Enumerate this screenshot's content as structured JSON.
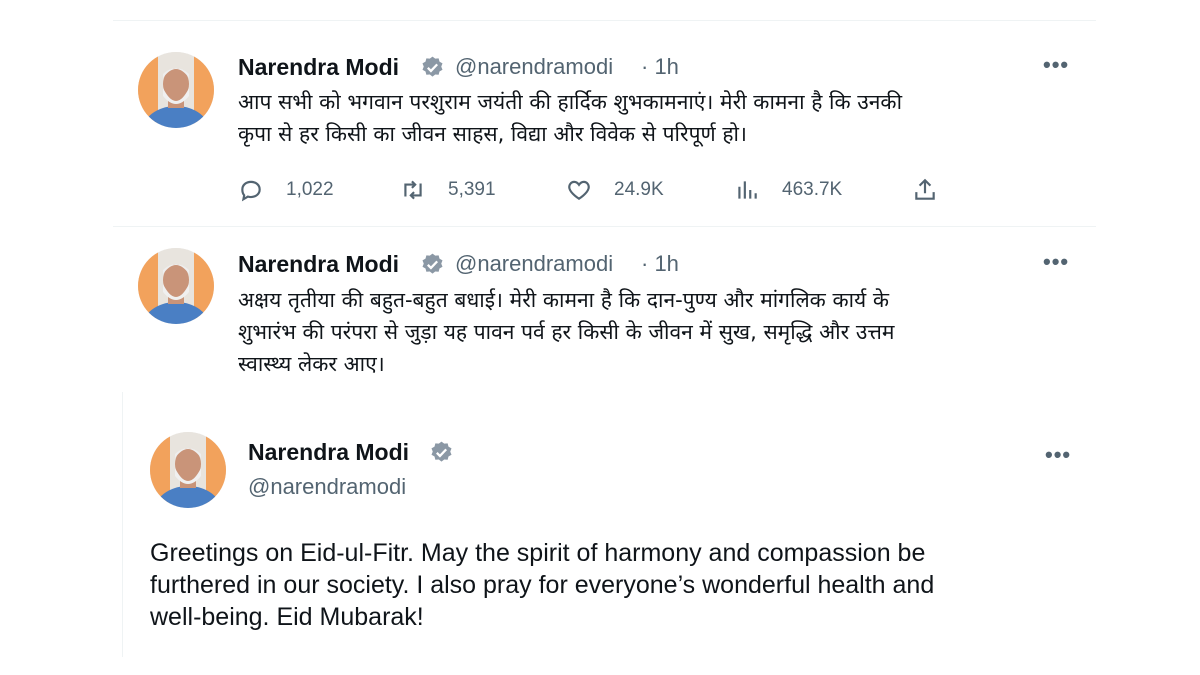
{
  "tweets": [
    {
      "author": "Narendra Modi",
      "handle": "@narendramodi",
      "time": "· 1h",
      "text_lines": [
        "आप सभी को भगवान परशुराम जयंती की हार्दिक शुभकामनाएं। मेरी कामना है कि उनकी",
        "कृपा से हर किसी का जीवन साहस, विद्या और विवेक से परिपूर्ण हो।"
      ],
      "replies": "1,022",
      "retweets": "5,391",
      "likes": "24.9K",
      "views": "463.7K"
    },
    {
      "author": "Narendra Modi",
      "handle": "@narendramodi",
      "time": "· 1h",
      "text_lines": [
        "अक्षय तृतीया की बहुत-बहुत बधाई। मेरी कामना है कि दान-पुण्य और मांगलिक कार्य के",
        "शुभारंभ की परंपरा से जुड़ा यह पावन पर्व हर किसी के जीवन में सुख, समृद्धि और उत्तम",
        "स्वास्थ्य लेकर आए।"
      ]
    },
    {
      "author": "Narendra Modi",
      "handle": "@narendramodi",
      "text_lines": [
        "Greetings on Eid-ul-Fitr. May the spirit of harmony and compassion be",
        "furthered in our society. I also pray for everyone’s wonderful health and",
        "well-being. Eid Mubarak!"
      ]
    }
  ],
  "more_label": "•••",
  "icons": [
    "avatar",
    "verified-badge-icon",
    "more-icon",
    "reply-icon",
    "retweet-icon",
    "like-icon",
    "views-icon",
    "share-icon"
  ],
  "colors": {
    "badge": "#8b98a5",
    "secondary": "#536471",
    "divider": "#eff3f4"
  }
}
